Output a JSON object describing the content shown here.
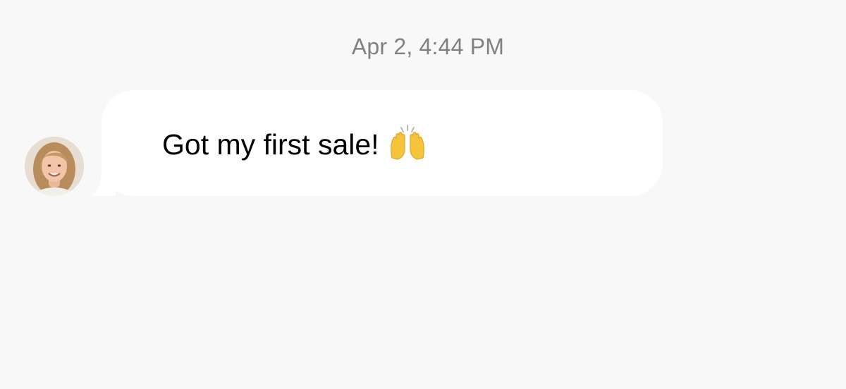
{
  "thread": {
    "timestamp": "Apr 2, 4:44 PM"
  },
  "message": {
    "text": "Got my first sale!",
    "emoji": "raising-hands-emoji",
    "sender_avatar": "avatar"
  },
  "colors": {
    "background": "#f8f8f8",
    "bubble": "#ffffff",
    "timestamp_text": "#808080",
    "message_text": "#000000",
    "emoji_yellow": "#f6c43a"
  }
}
